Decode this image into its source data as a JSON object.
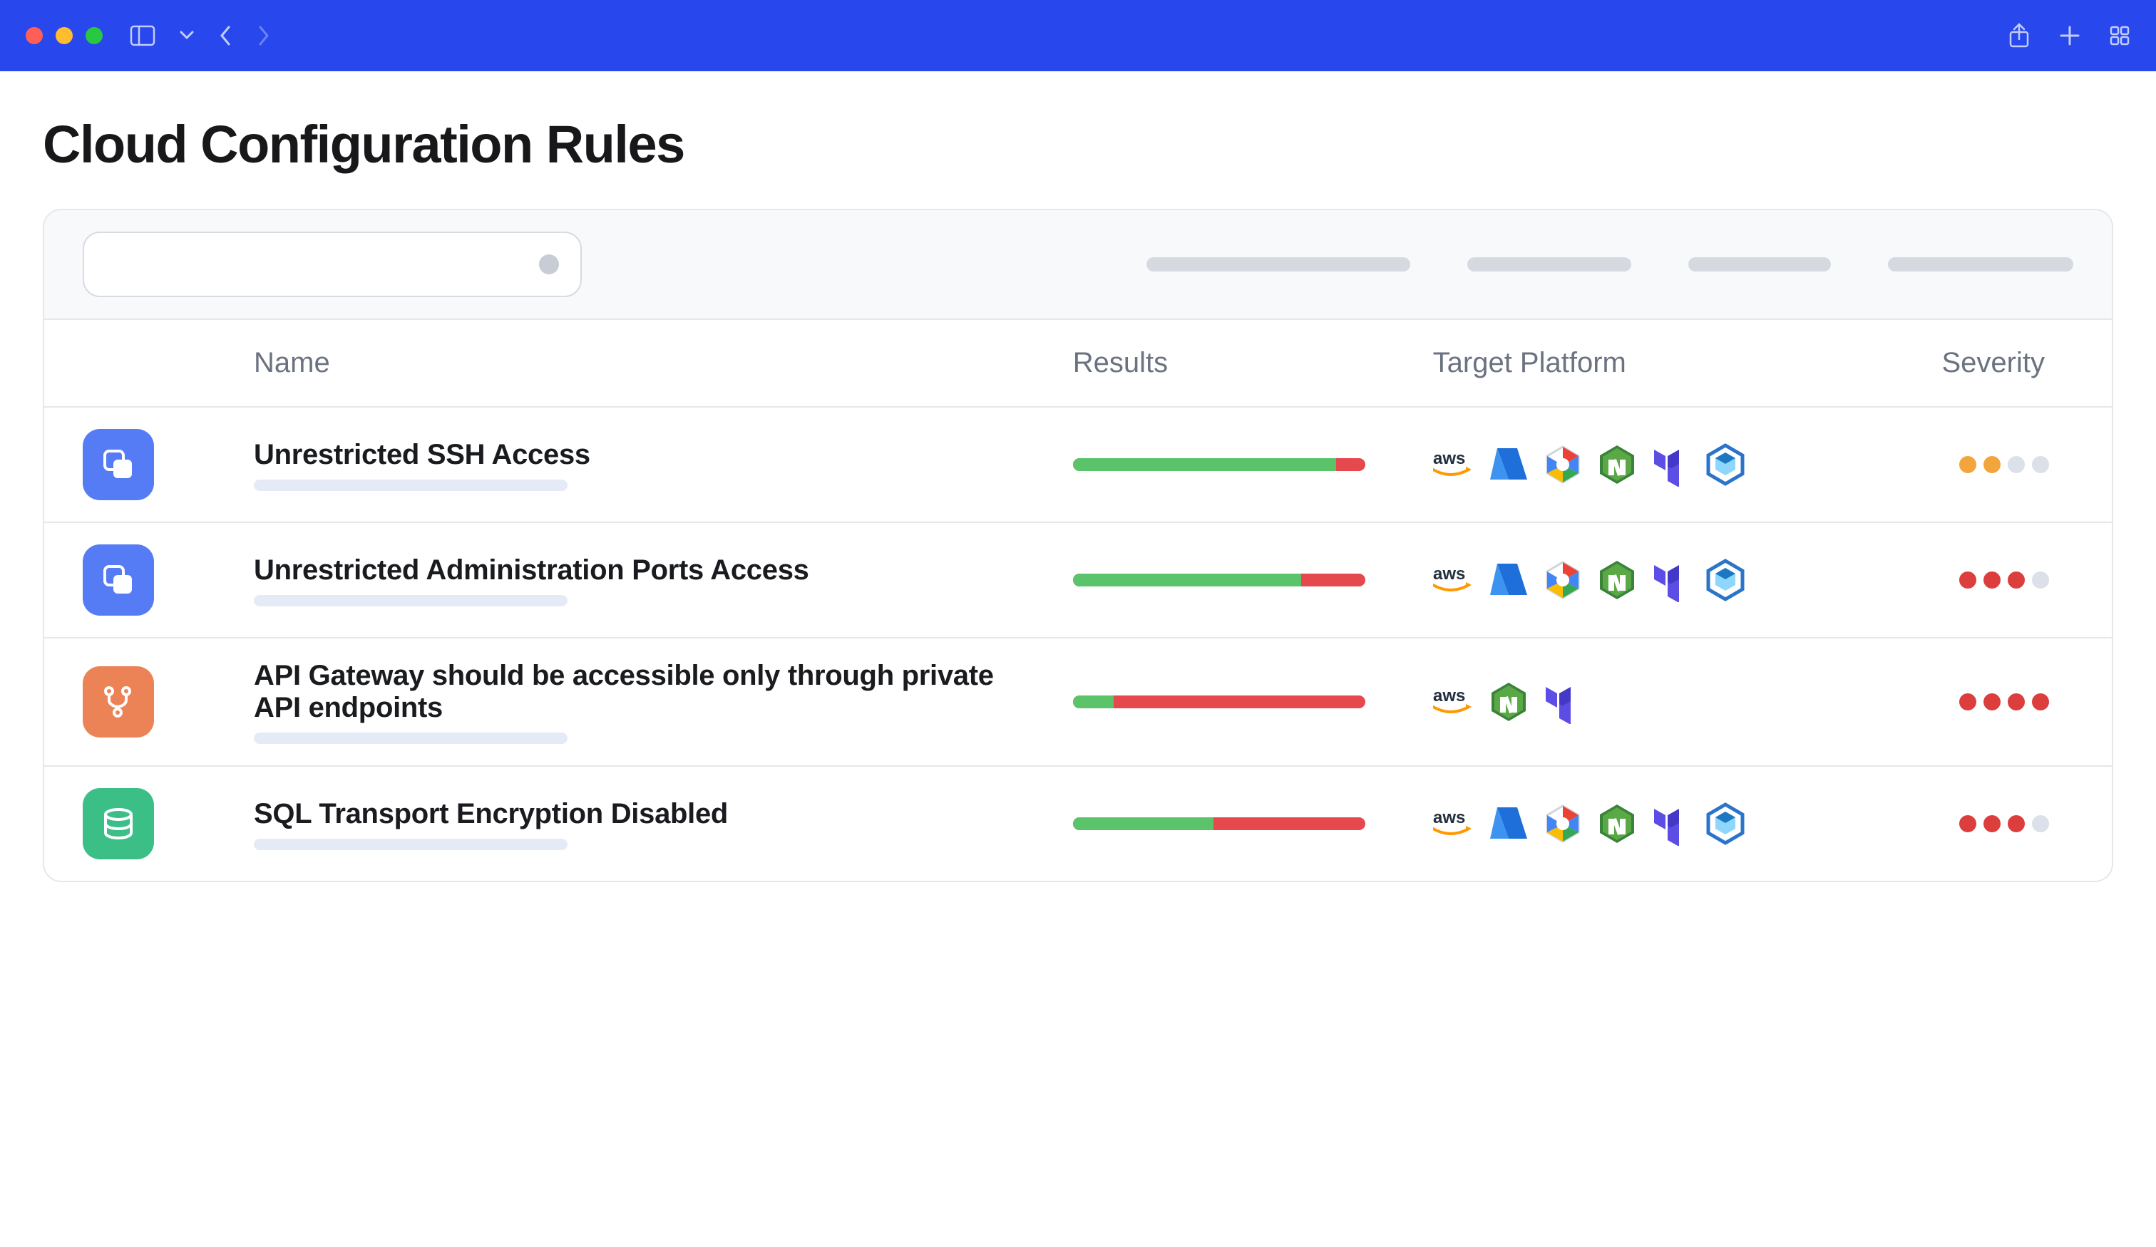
{
  "page": {
    "title": "Cloud Configuration Rules"
  },
  "columns": {
    "name": "Name",
    "results": "Results",
    "target": "Target Platform",
    "severity": "Severity"
  },
  "platforms": {
    "aws": {
      "label": "AWS"
    },
    "azure": {
      "label": "Azure"
    },
    "gcp": {
      "label": "Google Cloud"
    },
    "node": {
      "label": "Bitnami / Stack"
    },
    "terraform": {
      "label": "Terraform"
    },
    "webpack": {
      "label": "Webpack / Bundler"
    }
  },
  "rules": [
    {
      "name": "Unrestricted SSH Access",
      "icon": "copy",
      "icon_color": "blue",
      "results_pass_pct": 90,
      "platforms": [
        "aws",
        "azure",
        "gcp",
        "node",
        "terraform",
        "webpack"
      ],
      "severity_level": 2,
      "severity_color": "orange",
      "severity_max": 4
    },
    {
      "name": "Unrestricted Administration Ports Access",
      "icon": "copy",
      "icon_color": "blue",
      "results_pass_pct": 78,
      "platforms": [
        "aws",
        "azure",
        "gcp",
        "node",
        "terraform",
        "webpack"
      ],
      "severity_level": 3,
      "severity_color": "red",
      "severity_max": 4
    },
    {
      "name": "API Gateway should be accessible only through private API endpoints",
      "icon": "branch",
      "icon_color": "orange",
      "results_pass_pct": 14,
      "platforms": [
        "aws",
        "node",
        "terraform"
      ],
      "severity_level": 4,
      "severity_color": "red",
      "severity_max": 4
    },
    {
      "name": "SQL Transport Encryption Disabled",
      "icon": "database",
      "icon_color": "green",
      "results_pass_pct": 48,
      "platforms": [
        "aws",
        "azure",
        "gcp",
        "node",
        "terraform",
        "webpack"
      ],
      "severity_level": 3,
      "severity_color": "red",
      "severity_max": 4
    }
  ]
}
